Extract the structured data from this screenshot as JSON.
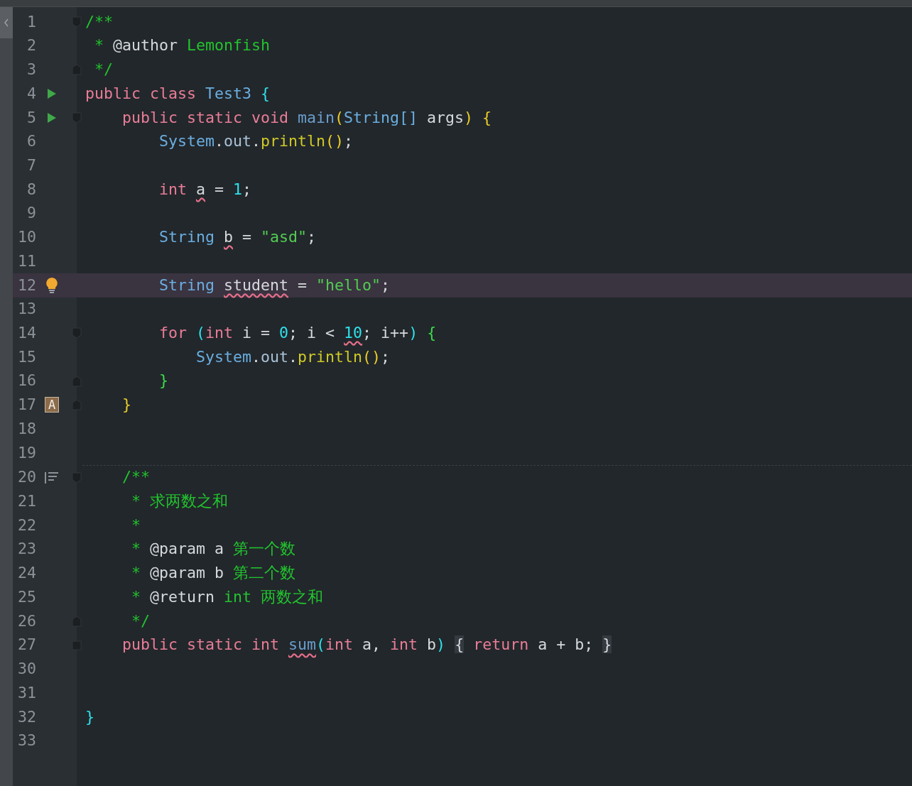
{
  "code_blocks": [
    {
      "lines": [
        {
          "number": "1",
          "current": false,
          "fold": {
            "kind": "start"
          },
          "tokens": [
            {
              "text": "/**",
              "kind": "comment"
            }
          ]
        },
        {
          "number": "2",
          "current": false,
          "tokens": [
            {
              "text": " * ",
              "kind": "comment"
            },
            {
              "text": "@author",
              "kind": "doc_tag"
            },
            {
              "text": " Lemonfish",
              "kind": "comment"
            }
          ]
        },
        {
          "number": "3",
          "current": false,
          "fold": {
            "kind": "end"
          },
          "tokens": [
            {
              "text": " */",
              "kind": "comment"
            }
          ]
        },
        {
          "number": "4",
          "current": false,
          "marker": {
            "kind": "run"
          },
          "tokens": [
            {
              "text": "public class ",
              "kind": "keyword"
            },
            {
              "text": "Test3 ",
              "kind": "type"
            },
            {
              "text": "{",
              "kind": "brace_cyan"
            }
          ]
        },
        {
          "number": "5",
          "current": false,
          "marker": {
            "kind": "run"
          },
          "fold": {
            "kind": "start"
          },
          "tokens": [
            {
              "text": "    public static void ",
              "kind": "keyword"
            },
            {
              "text": "main",
              "kind": "method_decl"
            },
            {
              "text": "(",
              "kind": "brace_yellow"
            },
            {
              "text": "String[]",
              "kind": "type"
            },
            {
              "text": " args",
              "kind": "plain"
            },
            {
              "text": ")",
              "kind": "brace_yellow"
            },
            {
              "text": " {",
              "kind": "brace_yellow"
            }
          ]
        },
        {
          "number": "6",
          "current": false,
          "tokens": [
            {
              "text": "        System",
              "kind": "type"
            },
            {
              "text": ".",
              "kind": "plain"
            },
            {
              "text": "out",
              "kind": "field"
            },
            {
              "text": ".",
              "kind": "plain"
            },
            {
              "text": "println",
              "kind": "method_call"
            },
            {
              "text": "()",
              "kind": "brace_yellow"
            },
            {
              "text": ";",
              "kind": "plain"
            }
          ]
        },
        {
          "number": "7",
          "current": false
        },
        {
          "number": "8",
          "current": false,
          "tokens": [
            {
              "text": "        int ",
              "kind": "keyword"
            },
            {
              "text": "a",
              "kind": "var_warn"
            },
            {
              "text": " = ",
              "kind": "plain"
            },
            {
              "text": "1",
              "kind": "number"
            },
            {
              "text": ";",
              "kind": "plain"
            }
          ]
        },
        {
          "number": "9",
          "current": false
        },
        {
          "number": "10",
          "current": false,
          "tokens": [
            {
              "text": "        String ",
              "kind": "type"
            },
            {
              "text": "b",
              "kind": "var_warn"
            },
            {
              "text": " = ",
              "kind": "plain"
            },
            {
              "text": "\"asd\"",
              "kind": "string"
            },
            {
              "text": ";",
              "kind": "plain"
            }
          ]
        },
        {
          "number": "11",
          "current": false
        },
        {
          "number": "12",
          "current": true,
          "marker": {
            "kind": "bulb"
          },
          "tokens": [
            {
              "text": "        String ",
              "kind": "type"
            },
            {
              "text": "student",
              "kind": "var_warn"
            },
            {
              "text": " = ",
              "kind": "plain"
            },
            {
              "text": "\"hello\"",
              "kind": "string"
            },
            {
              "text": ";",
              "kind": "plain"
            }
          ]
        },
        {
          "number": "13",
          "current": false
        },
        {
          "number": "14",
          "current": false,
          "fold": {
            "kind": "start"
          },
          "tokens": [
            {
              "text": "        for ",
              "kind": "keyword"
            },
            {
              "text": "(",
              "kind": "brace_cyan"
            },
            {
              "text": "int",
              "kind": "keyword"
            },
            {
              "text": " i = ",
              "kind": "plain"
            },
            {
              "text": "0",
              "kind": "number"
            },
            {
              "text": "; i < ",
              "kind": "plain"
            },
            {
              "text": "10",
              "kind": "number_warn"
            },
            {
              "text": "; i++",
              "kind": "plain"
            },
            {
              "text": ")",
              "kind": "brace_cyan"
            },
            {
              "text": " {",
              "kind": "brace_green"
            }
          ]
        },
        {
          "number": "15",
          "current": false,
          "tokens": [
            {
              "text": "            System",
              "kind": "type"
            },
            {
              "text": ".",
              "kind": "plain"
            },
            {
              "text": "out",
              "kind": "field"
            },
            {
              "text": ".",
              "kind": "plain"
            },
            {
              "text": "println",
              "kind": "method_call"
            },
            {
              "text": "()",
              "kind": "brace_yellow"
            },
            {
              "text": ";",
              "kind": "plain"
            }
          ]
        },
        {
          "number": "16",
          "current": false,
          "fold": {
            "kind": "end"
          },
          "tokens": [
            {
              "text": "        }",
              "kind": "brace_green"
            }
          ]
        },
        {
          "number": "17",
          "current": false,
          "marker": {
            "kind": "badge",
            "text": "A"
          },
          "fold": {
            "kind": "end"
          },
          "tokens": [
            {
              "text": "    }",
              "kind": "brace_yellow"
            }
          ]
        },
        {
          "number": "18",
          "current": false
        },
        {
          "number": "19",
          "current": false
        }
      ]
    },
    {
      "lines": [
        {
          "number": "20",
          "current": false,
          "marker": {
            "kind": "doc"
          },
          "fold": {
            "kind": "start"
          },
          "tokens": [
            {
              "text": "    /**",
              "kind": "comment"
            }
          ]
        },
        {
          "number": "21",
          "current": false,
          "tokens": [
            {
              "text": "     * 求两数之和",
              "kind": "comment"
            }
          ]
        },
        {
          "number": "22",
          "current": false,
          "tokens": [
            {
              "text": "     *",
              "kind": "comment"
            }
          ]
        },
        {
          "number": "23",
          "current": false,
          "tokens": [
            {
              "text": "     * ",
              "kind": "comment"
            },
            {
              "text": "@param",
              "kind": "doc_tag"
            },
            {
              "text": " a ",
              "kind": "plain"
            },
            {
              "text": "第一个数",
              "kind": "comment"
            }
          ]
        },
        {
          "number": "24",
          "current": false,
          "tokens": [
            {
              "text": "     * ",
              "kind": "comment"
            },
            {
              "text": "@param",
              "kind": "doc_tag"
            },
            {
              "text": " b ",
              "kind": "plain"
            },
            {
              "text": "第二个数",
              "kind": "comment"
            }
          ]
        },
        {
          "number": "25",
          "current": false,
          "tokens": [
            {
              "text": "     * ",
              "kind": "comment"
            },
            {
              "text": "@return",
              "kind": "doc_tag"
            },
            {
              "text": " int 两数之和",
              "kind": "comment"
            }
          ]
        },
        {
          "number": "26",
          "current": false,
          "fold": {
            "kind": "end"
          },
          "tokens": [
            {
              "text": "     */",
              "kind": "comment"
            }
          ]
        },
        {
          "number": "27",
          "current": false,
          "fold": {
            "kind": "collapsed"
          },
          "tokens": [
            {
              "text": "    public static int ",
              "kind": "keyword"
            },
            {
              "text": "sum",
              "kind": "method_warn"
            },
            {
              "text": "(",
              "kind": "brace_cyan"
            },
            {
              "text": "int",
              "kind": "keyword"
            },
            {
              "text": " a, ",
              "kind": "plain"
            },
            {
              "text": "int",
              "kind": "keyword"
            },
            {
              "text": " b",
              "kind": "plain"
            },
            {
              "text": ")",
              "kind": "brace_cyan"
            },
            {
              "text": " {",
              "kind": "folded"
            },
            {
              "text": " return",
              "kind": "keyword"
            },
            {
              "text": " a + b;",
              "kind": "plain"
            },
            {
              "text": " }",
              "kind": "folded"
            }
          ]
        },
        {
          "number": "30",
          "current": false
        },
        {
          "number": "31",
          "current": false
        },
        {
          "number": "32",
          "current": false,
          "tokens": [
            {
              "text": "}",
              "kind": "brace_cyan"
            }
          ]
        },
        {
          "number": "33",
          "current": false
        }
      ]
    }
  ]
}
